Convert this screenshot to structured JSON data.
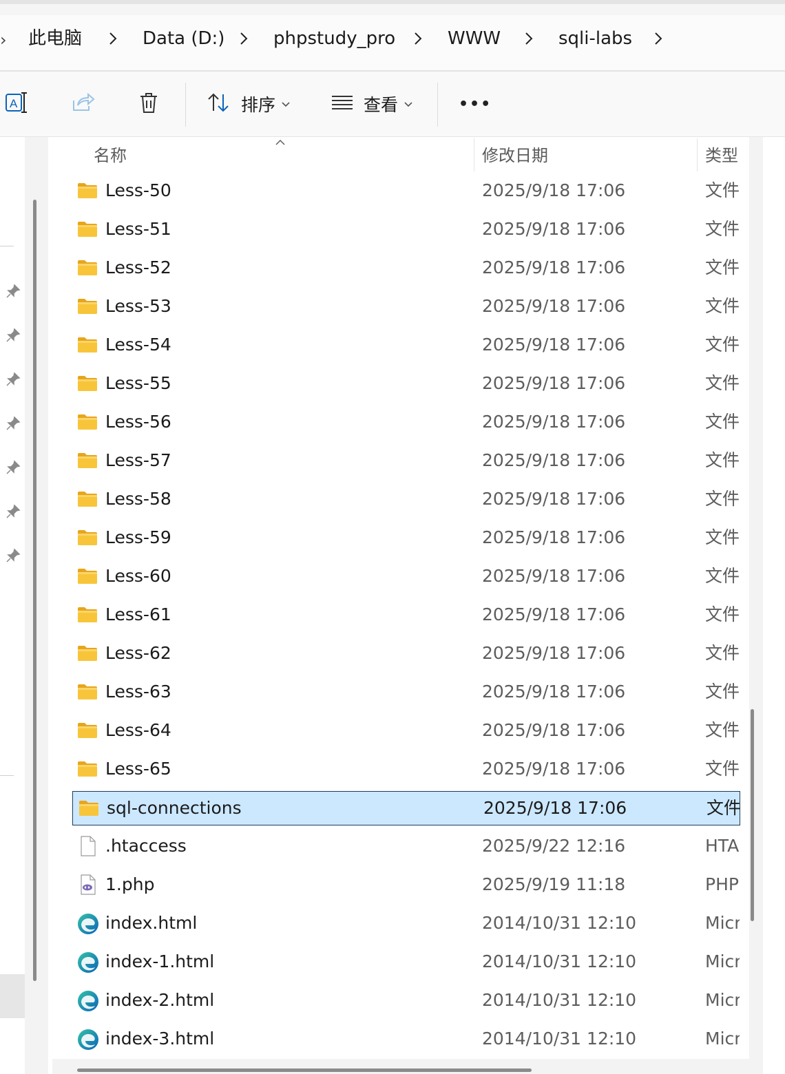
{
  "breadcrumb": {
    "lead": "›",
    "items": [
      "此电脑",
      "Data (D:)",
      "phpstudy_pro",
      "WWW",
      "sqli-labs"
    ]
  },
  "toolbar": {
    "sort_label": "排序",
    "view_label": "查看",
    "more_label": "•••"
  },
  "columns": {
    "name": "名称",
    "date": "修改日期",
    "type": "类型"
  },
  "files": [
    {
      "name": "Less-50",
      "date": "2025/9/18 17:06",
      "type": "文件夹",
      "icon": "folder-icon"
    },
    {
      "name": "Less-51",
      "date": "2025/9/18 17:06",
      "type": "文件夹",
      "icon": "folder-icon"
    },
    {
      "name": "Less-52",
      "date": "2025/9/18 17:06",
      "type": "文件夹",
      "icon": "folder-icon"
    },
    {
      "name": "Less-53",
      "date": "2025/9/18 17:06",
      "type": "文件夹",
      "icon": "folder-icon"
    },
    {
      "name": "Less-54",
      "date": "2025/9/18 17:06",
      "type": "文件夹",
      "icon": "folder-icon"
    },
    {
      "name": "Less-55",
      "date": "2025/9/18 17:06",
      "type": "文件夹",
      "icon": "folder-icon"
    },
    {
      "name": "Less-56",
      "date": "2025/9/18 17:06",
      "type": "文件夹",
      "icon": "folder-icon"
    },
    {
      "name": "Less-57",
      "date": "2025/9/18 17:06",
      "type": "文件夹",
      "icon": "folder-icon"
    },
    {
      "name": "Less-58",
      "date": "2025/9/18 17:06",
      "type": "文件夹",
      "icon": "folder-icon"
    },
    {
      "name": "Less-59",
      "date": "2025/9/18 17:06",
      "type": "文件夹",
      "icon": "folder-icon"
    },
    {
      "name": "Less-60",
      "date": "2025/9/18 17:06",
      "type": "文件夹",
      "icon": "folder-icon"
    },
    {
      "name": "Less-61",
      "date": "2025/9/18 17:06",
      "type": "文件夹",
      "icon": "folder-icon"
    },
    {
      "name": "Less-62",
      "date": "2025/9/18 17:06",
      "type": "文件夹",
      "icon": "folder-icon"
    },
    {
      "name": "Less-63",
      "date": "2025/9/18 17:06",
      "type": "文件夹",
      "icon": "folder-icon"
    },
    {
      "name": "Less-64",
      "date": "2025/9/18 17:06",
      "type": "文件夹",
      "icon": "folder-icon"
    },
    {
      "name": "Less-65",
      "date": "2025/9/18 17:06",
      "type": "文件夹",
      "icon": "folder-icon"
    },
    {
      "name": "sql-connections",
      "date": "2025/9/18 17:06",
      "type": "文件夹",
      "icon": "folder-icon",
      "selected": true
    },
    {
      "name": ".htaccess",
      "date": "2025/9/22 12:16",
      "type": "HTACCESS",
      "icon": "blank-file-icon"
    },
    {
      "name": "1.php",
      "date": "2025/9/19 11:18",
      "type": "PHP",
      "icon": "php-file-icon"
    },
    {
      "name": "index.html",
      "date": "2014/10/31 12:10",
      "type": "Microsoft",
      "icon": "edge-html-icon"
    },
    {
      "name": "index-1.html",
      "date": "2014/10/31 12:10",
      "type": "Microsoft",
      "icon": "edge-html-icon"
    },
    {
      "name": "index-2.html",
      "date": "2014/10/31 12:10",
      "type": "Microsoft",
      "icon": "edge-html-icon"
    },
    {
      "name": "index-3.html",
      "date": "2014/10/31 12:10",
      "type": "Microsoft",
      "icon": "edge-html-icon"
    }
  ],
  "colors": {
    "selection_bg": "#cce8ff",
    "selection_border": "#1f3a58",
    "folder_yellow": "#f8c53a",
    "accent_blue": "#0a63b8"
  }
}
